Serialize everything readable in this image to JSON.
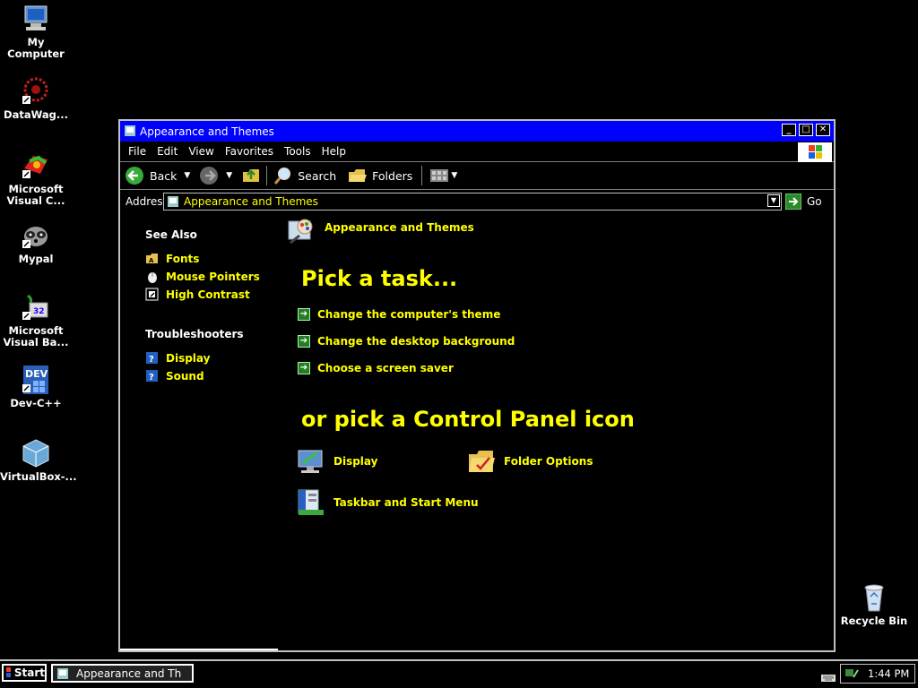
{
  "desktop": {
    "icons": [
      {
        "label": "My Computer",
        "icon": "my-computer-icon"
      },
      {
        "label": "DataWag...",
        "icon": "datawag-icon"
      },
      {
        "label": "Microsoft Visual C...",
        "icon": "visual-c-icon"
      },
      {
        "label": "Mypal",
        "icon": "mypal-icon"
      },
      {
        "label": "Microsoft Visual Ba...",
        "icon": "visual-basic-icon"
      },
      {
        "label": "Dev-C++",
        "icon": "dev-cpp-icon"
      },
      {
        "label": "VirtualBox-...",
        "icon": "virtualbox-icon"
      },
      {
        "label": "Recycle Bin",
        "icon": "recycle-bin-icon"
      }
    ]
  },
  "window": {
    "title": "Appearance and Themes",
    "menu": [
      "File",
      "Edit",
      "View",
      "Favorites",
      "Tools",
      "Help"
    ],
    "toolbar": {
      "back": "Back",
      "search": "Search",
      "folders": "Folders"
    },
    "address": {
      "label": "Address",
      "value": "Appearance and Themes",
      "go": "Go"
    },
    "left_pane": {
      "see_also_title": "See Also",
      "see_also": [
        "Fonts",
        "Mouse Pointers",
        "High Contrast"
      ],
      "troubleshooters_title": "Troubleshooters",
      "troubleshooters": [
        "Display",
        "Sound"
      ]
    },
    "content": {
      "category_title": "Appearance and Themes",
      "pick_task": "Pick a task...",
      "tasks": [
        "Change the computer's theme",
        "Change the desktop background",
        "Choose a screen saver"
      ],
      "pick_icon": "or pick a Control Panel icon",
      "icons": [
        "Display",
        "Folder Options",
        "Taskbar and Start Menu"
      ]
    }
  },
  "taskbar": {
    "start": "Start",
    "active_task": "Appearance and Th",
    "clock": "1:44 PM"
  },
  "colors": {
    "link": "#ffff00",
    "titlebar": "#0000ff",
    "background": "#000000"
  }
}
